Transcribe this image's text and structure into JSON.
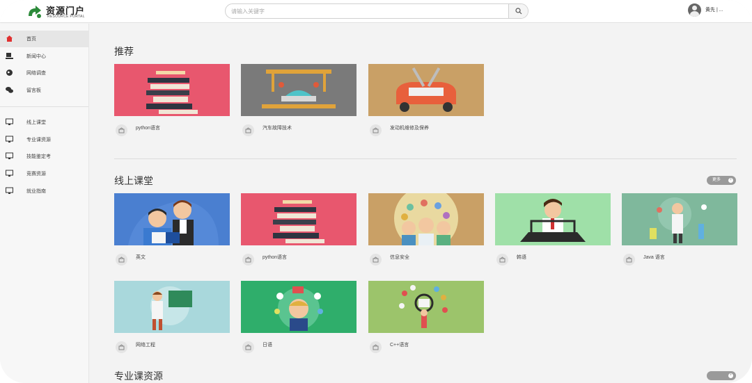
{
  "header": {
    "logo_title": "资源门户",
    "logo_subtitle": "RESOURCE PORTAL",
    "search_placeholder": "请输入关键字",
    "user_name": "黄先 | ..."
  },
  "sidebar": {
    "items": [
      {
        "label": "首页",
        "icon": "home-icon",
        "active": true
      },
      {
        "label": "新闻中心",
        "icon": "news-icon",
        "active": false
      },
      {
        "label": "网络调查",
        "icon": "globe-icon",
        "active": false
      },
      {
        "label": "留言板",
        "icon": "chat-icon",
        "active": false
      },
      {
        "label": "线上课堂",
        "icon": "monitor-icon",
        "active": false
      },
      {
        "label": "专业课资源",
        "icon": "monitor-icon",
        "active": false
      },
      {
        "label": "技能鉴定考",
        "icon": "monitor-icon",
        "active": false
      },
      {
        "label": "竞赛资源",
        "icon": "monitor-icon",
        "active": false
      },
      {
        "label": "就业指南",
        "icon": "monitor-icon",
        "active": false
      }
    ]
  },
  "sections": {
    "recommend": {
      "title": "推荐",
      "cards": [
        {
          "title": "python语言"
        },
        {
          "title": "汽车故障技术"
        },
        {
          "title": "发动机维修及保养"
        }
      ]
    },
    "online": {
      "title": "线上课堂",
      "more_label": "更多",
      "cards": [
        {
          "title": "英文"
        },
        {
          "title": "python语言"
        },
        {
          "title": "信息安全"
        },
        {
          "title": "韩语"
        },
        {
          "title": "Java 语言"
        },
        {
          "title": "网络工程"
        },
        {
          "title": "日语"
        },
        {
          "title": "C++语言"
        }
      ]
    },
    "professional": {
      "title": "专业课资源"
    }
  },
  "colors": {
    "pink": "#e8576e",
    "gray_thumb": "#7a7a7a",
    "tan": "#c9a066",
    "blue": "#4a7fd0",
    "mint": "#9fe0a8",
    "teal": "#7fb89c",
    "light_blue": "#a9d8dc",
    "green": "#2fae6b",
    "olive": "#9cc46b"
  }
}
